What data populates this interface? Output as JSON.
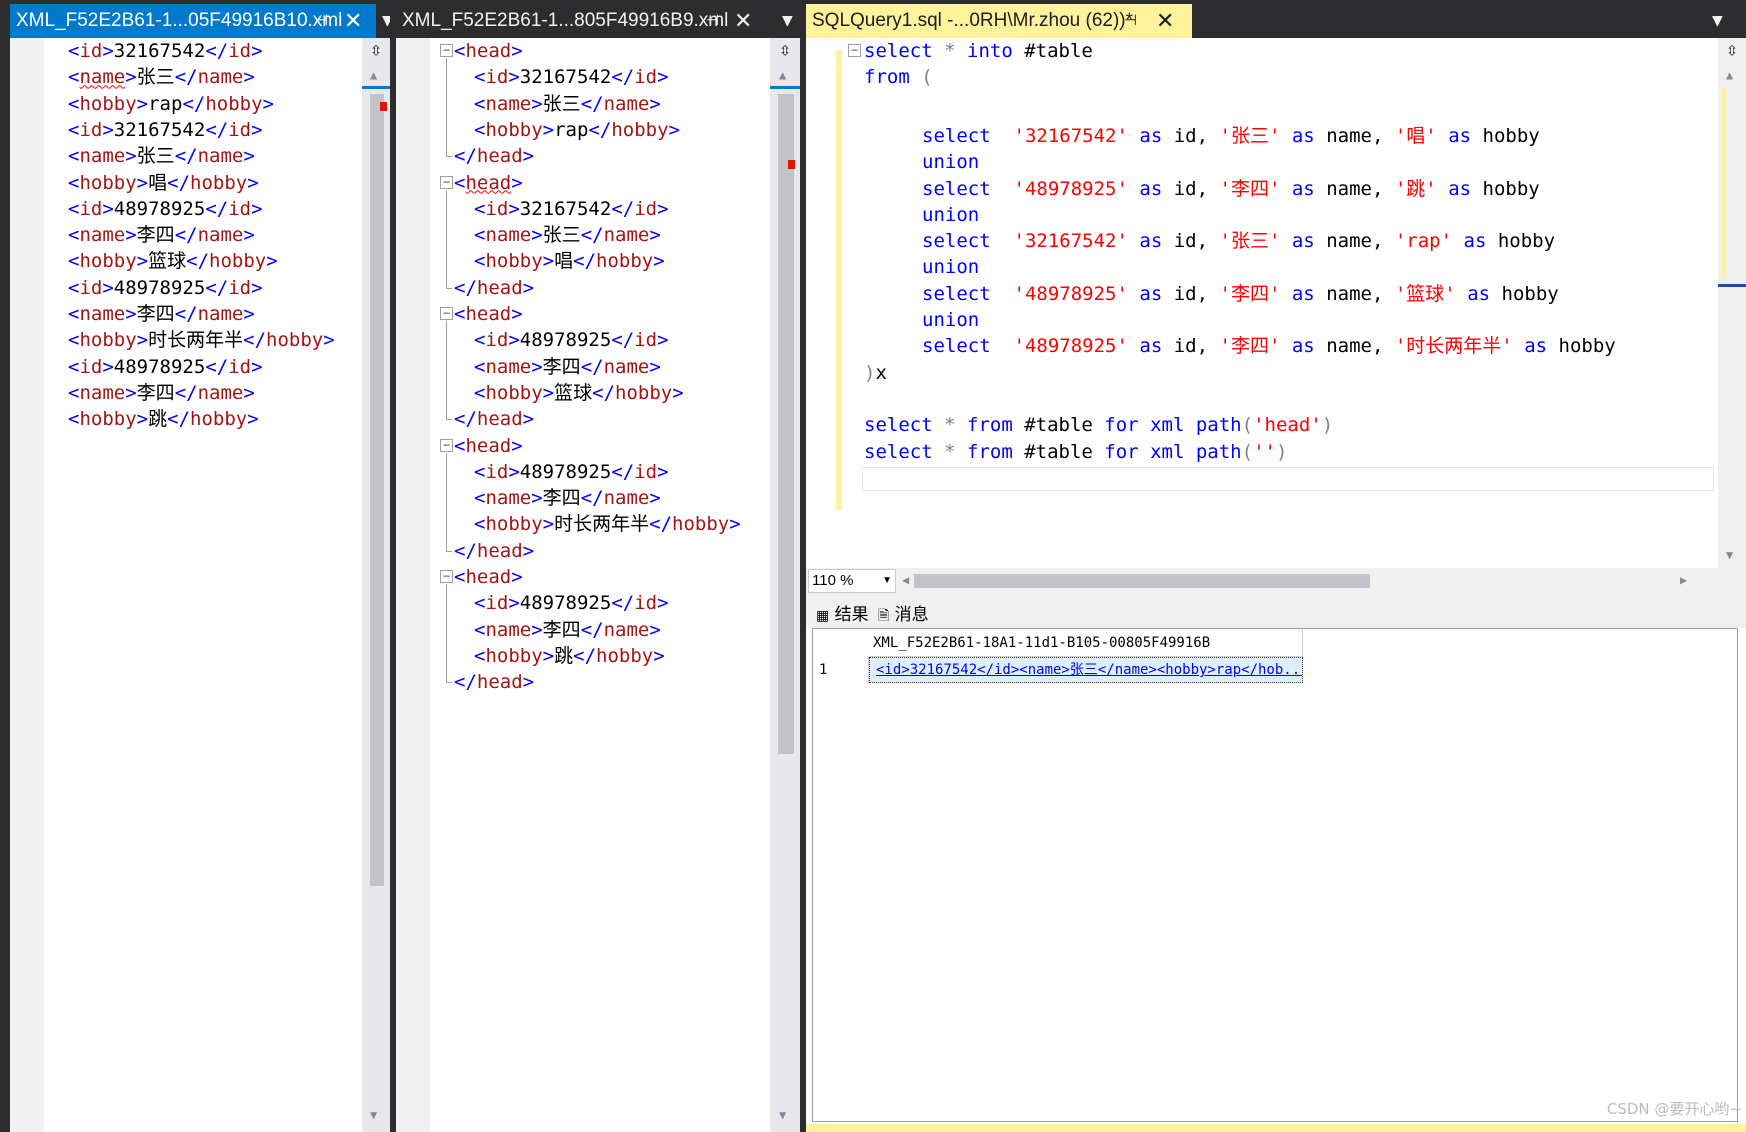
{
  "pane1": {
    "tab_title": "XML_F52E2B61-1...05F49916B10.xml",
    "lines": [
      {
        "open": "id",
        "value": "32167542",
        "close": "id"
      },
      {
        "open": "name",
        "value": "张三",
        "close": "name"
      },
      {
        "open": "hobby",
        "value": "rap",
        "close": "hobby"
      },
      {
        "open": "id",
        "value": "32167542",
        "close": "id"
      },
      {
        "open": "name",
        "value": "张三",
        "close": "name"
      },
      {
        "open": "hobby",
        "value": "唱",
        "close": "hobby"
      },
      {
        "open": "id",
        "value": "48978925",
        "close": "id"
      },
      {
        "open": "name",
        "value": "李四",
        "close": "name"
      },
      {
        "open": "hobby",
        "value": "篮球",
        "close": "hobby"
      },
      {
        "open": "id",
        "value": "48978925",
        "close": "id"
      },
      {
        "open": "name",
        "value": "李四",
        "close": "name"
      },
      {
        "open": "hobby",
        "value": "时长两年半",
        "close": "hobby"
      },
      {
        "open": "id",
        "value": "48978925",
        "close": "id"
      },
      {
        "open": "name",
        "value": "李四",
        "close": "name"
      },
      {
        "open": "hobby",
        "value": "跳",
        "close": "hobby"
      }
    ]
  },
  "pane2": {
    "tab_title": "XML_F52E2B61-1...805F49916B9.xml",
    "groups": [
      {
        "tag": "head",
        "rows": [
          [
            "id",
            "32167542"
          ],
          [
            "name",
            "张三"
          ],
          [
            "hobby",
            "rap"
          ]
        ]
      },
      {
        "tag": "head",
        "rows": [
          [
            "id",
            "32167542"
          ],
          [
            "name",
            "张三"
          ],
          [
            "hobby",
            "唱"
          ]
        ]
      },
      {
        "tag": "head",
        "rows": [
          [
            "id",
            "48978925"
          ],
          [
            "name",
            "李四"
          ],
          [
            "hobby",
            "篮球"
          ]
        ]
      },
      {
        "tag": "head",
        "rows": [
          [
            "id",
            "48978925"
          ],
          [
            "name",
            "李四"
          ],
          [
            "hobby",
            "时长两年半"
          ]
        ]
      },
      {
        "tag": "head",
        "rows": [
          [
            "id",
            "48978925"
          ],
          [
            "name",
            "李四"
          ],
          [
            "hobby",
            "跳"
          ]
        ]
      }
    ]
  },
  "pane3": {
    "tab_title": "SQLQuery1.sql -...0RH\\Mr.zhou (62))*",
    "sql": {
      "l1_kw1": "select",
      "l1_star": "*",
      "l1_kw2": "into",
      "l1_rest": "#table",
      "l2_kw": "from",
      "l2_paren": "(",
      "selects": [
        {
          "id": "'32167542'",
          "name": "'张三'",
          "hobby": "'唱'"
        },
        {
          "id": "'48978925'",
          "name": "'李四'",
          "hobby": "'跳'"
        },
        {
          "id": "'32167542'",
          "name": "'张三'",
          "hobby": "'rap'"
        },
        {
          "id": "'48978925'",
          "name": "'李四'",
          "hobby": "'篮球'"
        },
        {
          "id": "'48978925'",
          "name": "'李四'",
          "hobby": "'时长两年半'"
        }
      ],
      "kw_select": "select",
      "kw_union": "union",
      "kw_as": "as",
      "col_id": "id,",
      "col_name": "name,",
      "col_hobby": "hobby",
      "close_paren": ")",
      "alias": "x",
      "q1": {
        "select": "select",
        "star": "*",
        "from": "from",
        "table": "#table",
        "for": "for",
        "xml": "xml",
        "path": "path",
        "open": "(",
        "arg": "'head'",
        "close": ")"
      },
      "q2": {
        "select": "select",
        "star": "*",
        "from": "from",
        "table": "#table",
        "for": "for",
        "xml": "xml",
        "path": "path",
        "open": "(",
        "arg": "''",
        "close": ")"
      }
    },
    "zoom": "110 %",
    "results_tab": "结果",
    "messages_tab": "消息",
    "grid_header": "XML_F52E2B61-18A1-11d1-B105-00805F49916B",
    "row_number": "1",
    "cell_value": "<id>32167542</id><name>张三</name><hobby>rap</hob..."
  },
  "watermark": "CSDN @要开心哟~"
}
